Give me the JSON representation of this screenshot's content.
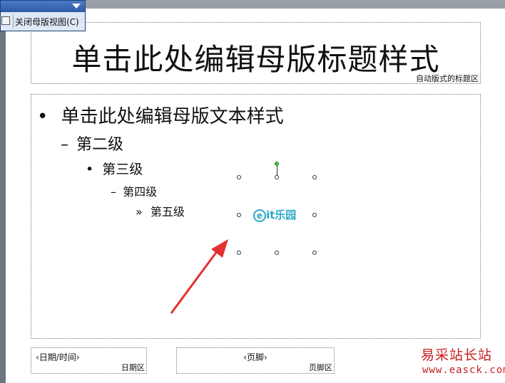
{
  "toolbar": {
    "close_master_view_label": "关闭母版视图(C)",
    "dropdown_icon": "chevron-down-icon",
    "view_icon": "slide-view-icon"
  },
  "title_placeholder": {
    "text": "单击此处编辑母版标题样式",
    "area_label": "自动版式的标题区"
  },
  "body_placeholder": {
    "levels": [
      {
        "bullet": "•",
        "text": "单击此处编辑母版文本样式"
      },
      {
        "bullet": "–",
        "text": "第二级"
      },
      {
        "bullet": "•",
        "text": "第三级"
      },
      {
        "bullet": "–",
        "text": "第四级"
      },
      {
        "bullet": "»",
        "text": "第五级"
      }
    ]
  },
  "footer": {
    "date_text": "‹日期/时间›",
    "date_area_label": "日期区",
    "footer_text": "‹页脚›",
    "footer_area_label": "页脚区"
  },
  "selected_image": {
    "logo_text": "it乐园",
    "logo_mark": "e"
  },
  "watermark": {
    "name": "易采站长站",
    "url": "www.easck.com"
  },
  "colors": {
    "toolbar_bg": "#2f5fa8",
    "arrow": "#e53030",
    "logo": "#2aa9c9",
    "watermark": "#c81e1e"
  }
}
